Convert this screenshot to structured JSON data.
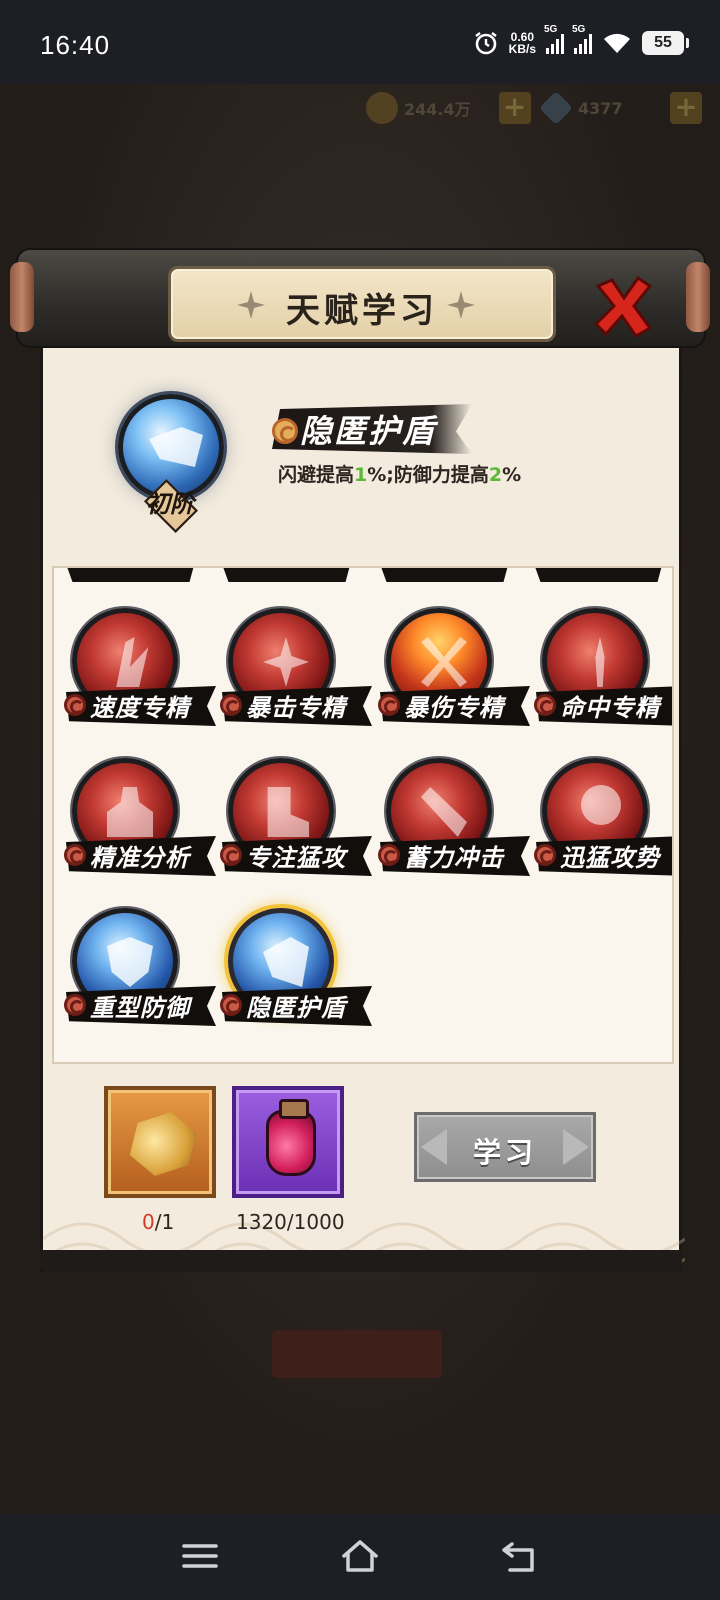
{
  "status_bar": {
    "time": "16:40",
    "net_speed_value": "0.60",
    "net_speed_unit": "KB/s",
    "signal_1": "5G",
    "signal_2": "5G",
    "battery": "55",
    "icons": [
      "alarm-icon",
      "signal-icon",
      "signal-icon",
      "wifi-icon",
      "battery-icon"
    ]
  },
  "background": {
    "coins": "244.4万",
    "gems": "4377"
  },
  "dialog": {
    "title": "天赋学习",
    "selected": {
      "name": "隐匿护盾",
      "rank": "初阶",
      "desc_part1": "闪避提高",
      "desc_val1": "1",
      "desc_part2": "%;防御力提高",
      "desc_val2": "2",
      "desc_part3": "%"
    },
    "talents": [
      {
        "label": "速度专精",
        "icon": "speed-talent-icon"
      },
      {
        "label": "暴击专精",
        "icon": "crit-talent-icon"
      },
      {
        "label": "暴伤专精",
        "icon": "crit-damage-talent-icon"
      },
      {
        "label": "命中专精",
        "icon": "accuracy-talent-icon"
      },
      {
        "label": "精准分析",
        "icon": "precision-talent-icon"
      },
      {
        "label": "专注猛攻",
        "icon": "focus-attack-talent-icon"
      },
      {
        "label": "蓄力冲击",
        "icon": "charge-strike-talent-icon"
      },
      {
        "label": "迅猛攻势",
        "icon": "swift-offense-talent-icon"
      },
      {
        "label": "重型防御",
        "icon": "heavy-defense-talent-icon"
      },
      {
        "label": "隐匿护盾",
        "icon": "hidden-shield-talent-icon"
      }
    ],
    "materials": [
      {
        "have": "0",
        "need": "/1",
        "icon": "talent-token-icon"
      },
      {
        "have": "1320",
        "need": "/1000",
        "icon": "potion-jar-icon"
      }
    ],
    "learn_button": "学习"
  },
  "nav_bar": {
    "icons": [
      "menu-icon",
      "home-icon",
      "back-icon"
    ]
  },
  "colors": {
    "accent_green": "#5cb83a",
    "insufficient_red": "#d23a2a",
    "selected_ring": "#f2c33a"
  }
}
